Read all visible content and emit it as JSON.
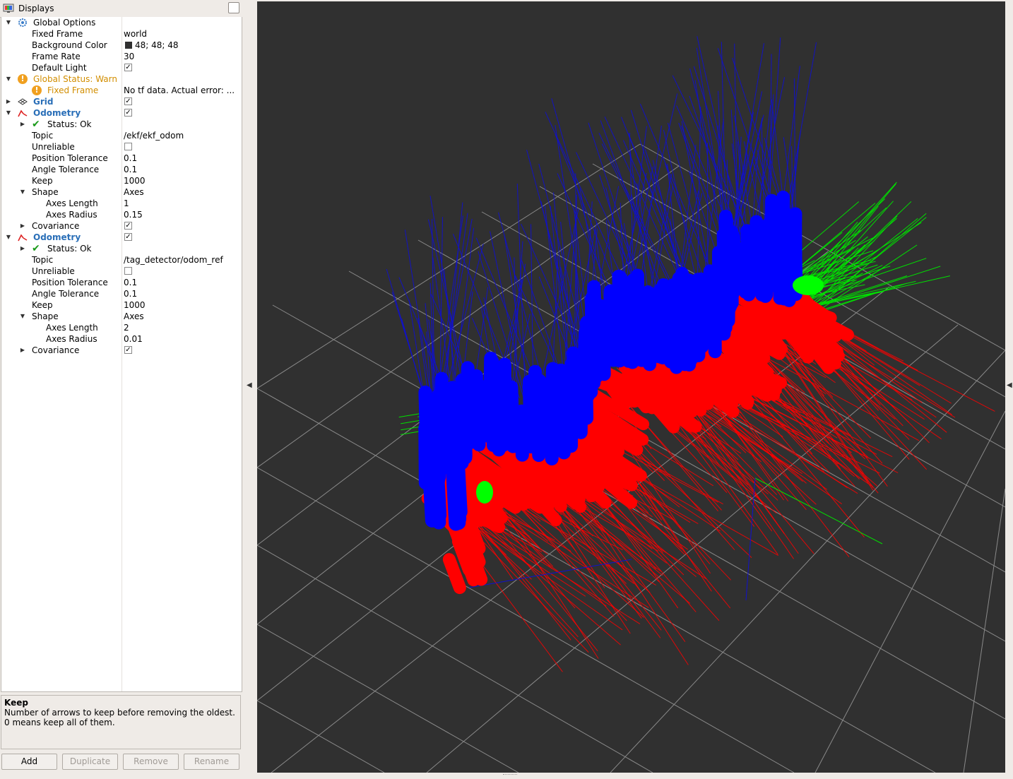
{
  "panel": {
    "title": "Displays",
    "tree": [
      {
        "name": "Global Options",
        "value": ""
      },
      {
        "name": "Fixed Frame",
        "value": "world"
      },
      {
        "name": "Background Color",
        "value": "48; 48; 48"
      },
      {
        "name": "Frame Rate",
        "value": "30"
      },
      {
        "name": "Default Light",
        "value": ""
      },
      {
        "name": "Global Status: Warn",
        "value": ""
      },
      {
        "name": "Fixed Frame",
        "value": "No tf data.  Actual error: ..."
      },
      {
        "name": "Grid",
        "value": ""
      },
      {
        "name": "Odometry",
        "value": ""
      },
      {
        "name": "Status: Ok",
        "value": ""
      },
      {
        "name": "Topic",
        "value": "/ekf/ekf_odom"
      },
      {
        "name": "Unreliable",
        "value": ""
      },
      {
        "name": "Position Tolerance",
        "value": "0.1"
      },
      {
        "name": "Angle Tolerance",
        "value": "0.1"
      },
      {
        "name": "Keep",
        "value": "1000"
      },
      {
        "name": "Shape",
        "value": "Axes"
      },
      {
        "name": "Axes Length",
        "value": "1"
      },
      {
        "name": "Axes Radius",
        "value": "0.15"
      },
      {
        "name": "Covariance",
        "value": ""
      },
      {
        "name": "Odometry",
        "value": ""
      },
      {
        "name": "Status: Ok",
        "value": ""
      },
      {
        "name": "Topic",
        "value": "/tag_detector/odom_ref"
      },
      {
        "name": "Unreliable",
        "value": ""
      },
      {
        "name": "Position Tolerance",
        "value": "0.1"
      },
      {
        "name": "Angle Tolerance",
        "value": "0.1"
      },
      {
        "name": "Keep",
        "value": "1000"
      },
      {
        "name": "Shape",
        "value": "Axes"
      },
      {
        "name": "Axes Length",
        "value": "2"
      },
      {
        "name": "Axes Radius",
        "value": "0.01"
      },
      {
        "name": "Covariance",
        "value": ""
      }
    ]
  },
  "description": {
    "title": "Keep",
    "line1": "Number of arrows to keep before removing the oldest.",
    "line2": "0 means keep all of them."
  },
  "buttons": {
    "add": "Add",
    "duplicate": "Duplicate",
    "remove": "Remove",
    "rename": "Rename"
  },
  "colors": {
    "background": "#303030",
    "axis_x": "#ff0000",
    "axis_y": "#00ff00",
    "axis_z": "#0000ff",
    "warn": "#d28e00",
    "display_name": "#2a6fb8"
  }
}
